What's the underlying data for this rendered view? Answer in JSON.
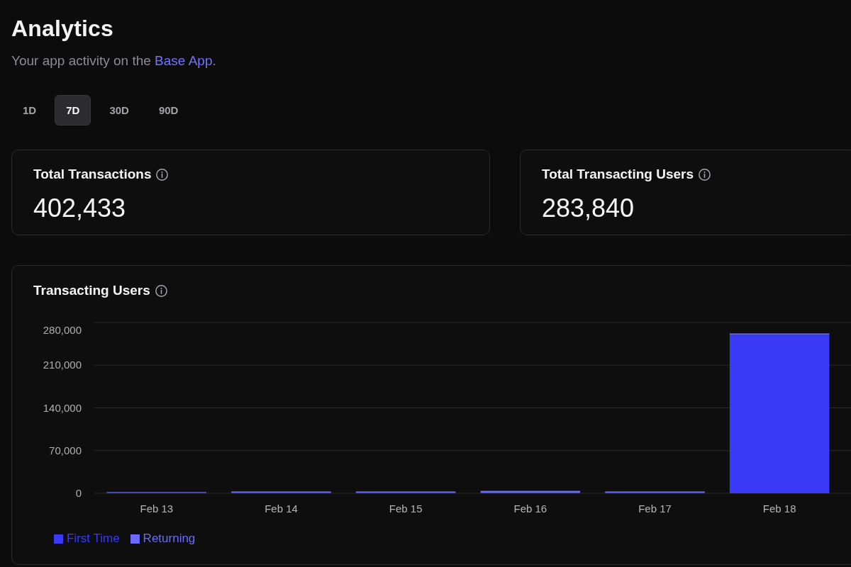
{
  "header": {
    "title": "Analytics",
    "subtitle": {
      "before": "Your app activity on the ",
      "link": "Base App",
      "after": "."
    }
  },
  "tabs": [
    {
      "label": "1D",
      "selected": false
    },
    {
      "label": "7D",
      "selected": true
    },
    {
      "label": "30D",
      "selected": false
    },
    {
      "label": "90D",
      "selected": false
    }
  ],
  "stats": [
    {
      "label": "Total Transactions",
      "value": "402,433"
    },
    {
      "label": "Total Transacting Users",
      "value": "283,840"
    }
  ],
  "chart_card": {
    "title": "Transacting Users",
    "chart_data": {
      "type": "bar",
      "categories": [
        "Feb 13",
        "Feb 14",
        "Feb 15",
        "Feb 16",
        "Feb 17",
        "Feb 18"
      ],
      "series": [
        {
          "name": "First Time",
          "color": "#3b3bf7",
          "values": [
            1000,
            1000,
            1000,
            1000,
            1000,
            260000
          ]
        },
        {
          "name": "Returning",
          "color": "#6a6aff",
          "values": [
            1000,
            2000,
            2000,
            3000,
            2000,
            2000
          ]
        }
      ],
      "stacked": true,
      "grid": true,
      "ylim": [
        0,
        280000
      ],
      "yticks": [
        {
          "value": 0,
          "label": "0"
        },
        {
          "value": 70000,
          "label": "70,000"
        },
        {
          "value": 140000,
          "label": "140,000"
        },
        {
          "value": 210000,
          "label": "210,000"
        },
        {
          "value": 280000,
          "label": "280,000"
        }
      ]
    }
  }
}
